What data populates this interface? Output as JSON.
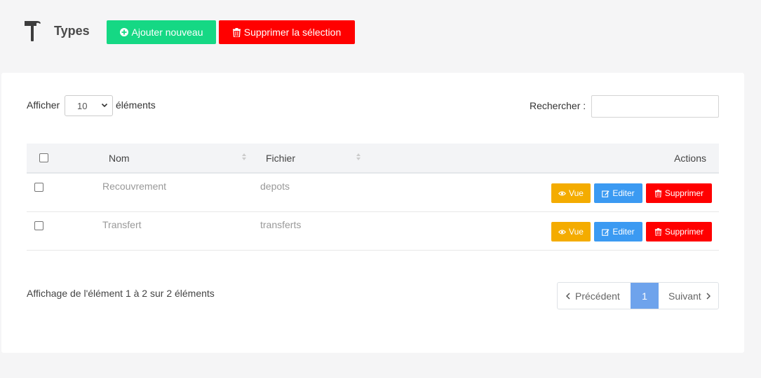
{
  "header": {
    "title": "Types",
    "add_button": "Ajouter nouveau",
    "delete_selection_button": "Supprimer la sélection"
  },
  "length": {
    "before": "Afficher",
    "value": "10",
    "after": "éléments"
  },
  "search": {
    "label": "Rechercher :",
    "value": ""
  },
  "table": {
    "columns": [
      "Nom",
      "Fichier",
      "Actions"
    ],
    "rows": [
      {
        "nom": "Recouvrement",
        "fichier": "depots"
      },
      {
        "nom": "Transfert",
        "fichier": "transferts"
      }
    ],
    "actions": {
      "view": "Vue",
      "edit": "Editer",
      "delete": "Supprimer"
    }
  },
  "footer": {
    "info": "Affichage de l'élément 1 à 2 sur 2 éléments",
    "prev": "Précédent",
    "current_page": "1",
    "next": "Suivant"
  },
  "colors": {
    "add": "#15d884",
    "delete": "#ff0000",
    "view": "#f4ac00",
    "edit": "#3b9af2",
    "active_page": "#6ea3ec"
  }
}
